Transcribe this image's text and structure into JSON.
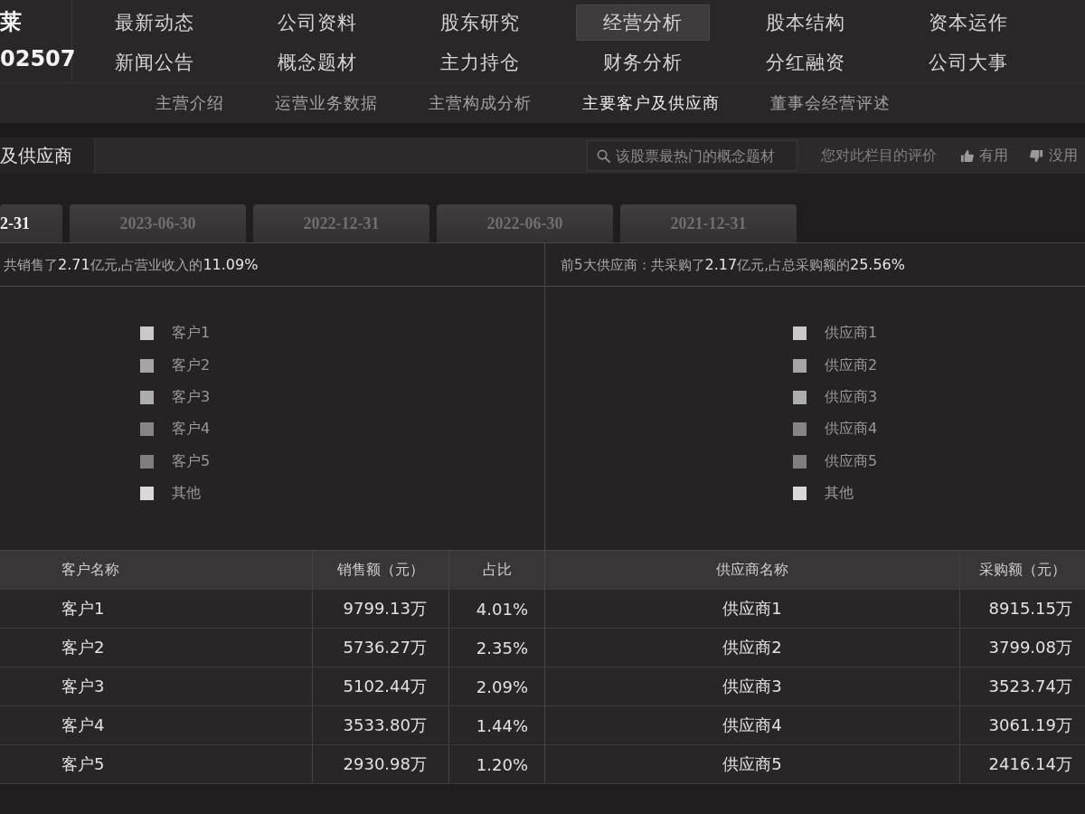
{
  "stock": {
    "name": "莱",
    "code": "02507"
  },
  "main_nav": [
    {
      "label": "最新动态",
      "selected": false
    },
    {
      "label": "公司资料",
      "selected": false
    },
    {
      "label": "股东研究",
      "selected": false
    },
    {
      "label": "经营分析",
      "selected": true
    },
    {
      "label": "股本结构",
      "selected": false
    },
    {
      "label": "资本运作",
      "selected": false
    },
    {
      "label": "新闻公告",
      "selected": false
    },
    {
      "label": "概念题材",
      "selected": false
    },
    {
      "label": "主力持仓",
      "selected": false
    },
    {
      "label": "财务分析",
      "selected": false
    },
    {
      "label": "分红融资",
      "selected": false
    },
    {
      "label": "公司大事",
      "selected": false
    }
  ],
  "sub_nav": [
    {
      "label": "主营介绍",
      "selected": false
    },
    {
      "label": "运营业务数据",
      "selected": false
    },
    {
      "label": "主营构成分析",
      "selected": false
    },
    {
      "label": "主要客户及供应商",
      "selected": true
    },
    {
      "label": "董事会经营评述",
      "selected": false
    }
  ],
  "section": {
    "title": "及供应商",
    "search": {
      "placeholder": "该股票最热门的概念题材"
    },
    "rating": {
      "prompt": "您对此栏目的评价",
      "useful": "有用",
      "useless": "没用"
    }
  },
  "period_tabs": [
    {
      "label": "2-31",
      "selected": true
    },
    {
      "label": "2023-06-30",
      "selected": false
    },
    {
      "label": "2022-12-31",
      "selected": false
    },
    {
      "label": "2022-06-30",
      "selected": false
    },
    {
      "label": "2021-12-31",
      "selected": false
    }
  ],
  "customers": {
    "summary": "共销售了**2.71**亿元,占营业收入的**11.09%**",
    "legend": [
      {
        "label": "客户1",
        "color": "#c9c9c9"
      },
      {
        "label": "客户2",
        "color": "#a6a6a6"
      },
      {
        "label": "客户3",
        "color": "#adadad"
      },
      {
        "label": "客户4",
        "color": "#858585"
      },
      {
        "label": "客户5",
        "color": "#7f7f7f"
      },
      {
        "label": "其他",
        "color": "#d9d9d9"
      }
    ],
    "columns": [
      "客户名称",
      "销售额（元）",
      "占比"
    ],
    "rows": [
      {
        "name": "客户1",
        "sales": "9799.13万",
        "share": "4.01%"
      },
      {
        "name": "客户2",
        "sales": "5736.27万",
        "share": "2.35%"
      },
      {
        "name": "客户3",
        "sales": "5102.44万",
        "share": "2.09%"
      },
      {
        "name": "客户4",
        "sales": "3533.80万",
        "share": "1.44%"
      },
      {
        "name": "客户5",
        "sales": "2930.98万",
        "share": "1.20%"
      }
    ]
  },
  "suppliers": {
    "summary": "前5大供应商：共采购了**2.17**亿元,占总采购额的**25.56%**",
    "legend": [
      {
        "label": "供应商1",
        "color": "#c9c9c9"
      },
      {
        "label": "供应商2",
        "color": "#a6a6a6"
      },
      {
        "label": "供应商3",
        "color": "#adadad"
      },
      {
        "label": "供应商4",
        "color": "#858585"
      },
      {
        "label": "供应商5",
        "color": "#7f7f7f"
      },
      {
        "label": "其他",
        "color": "#d9d9d9"
      }
    ],
    "columns": [
      "供应商名称",
      "采购额（元）"
    ],
    "rows": [
      {
        "name": "供应商1",
        "purchase": "8915.15万"
      },
      {
        "name": "供应商2",
        "purchase": "3799.08万"
      },
      {
        "name": "供应商3",
        "purchase": "3523.74万"
      },
      {
        "name": "供应商4",
        "purchase": "3061.19万"
      },
      {
        "name": "供应商5",
        "purchase": "2416.14万"
      }
    ]
  }
}
